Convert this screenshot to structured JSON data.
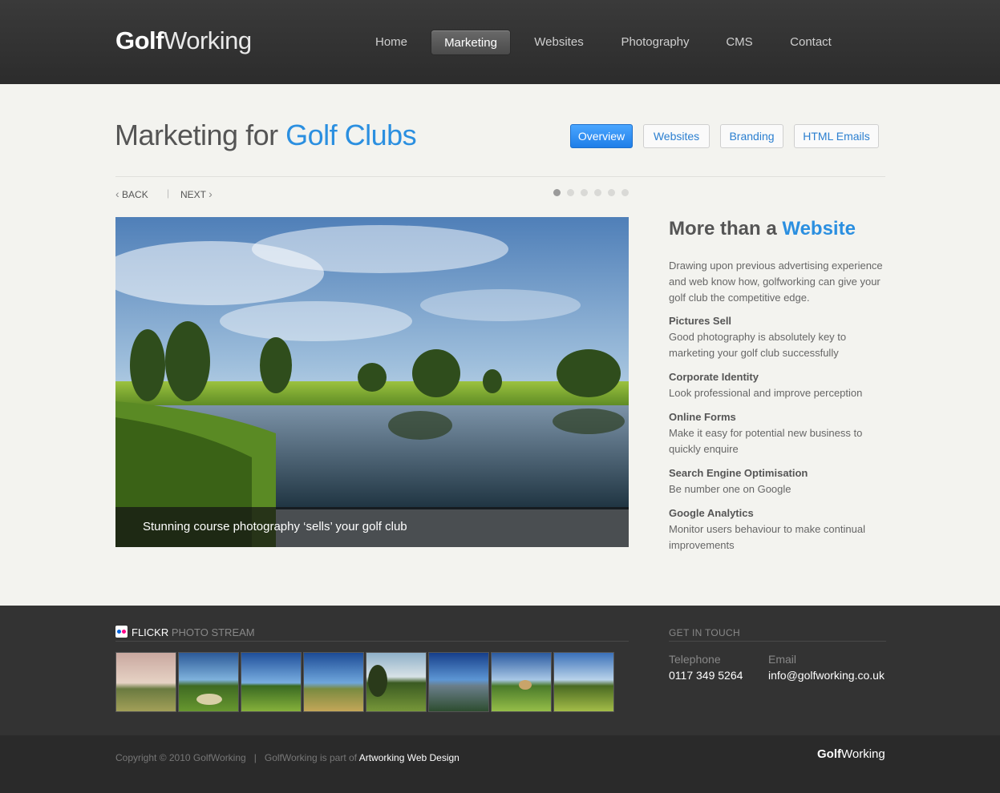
{
  "header": {
    "logo_bold": "Golf",
    "logo_light": "Working",
    "nav": [
      "Home",
      "Marketing",
      "Websites",
      "Photography",
      "CMS",
      "Contact"
    ],
    "active_nav": "Marketing"
  },
  "main": {
    "title_plain": "Marketing for ",
    "title_accent": "Golf Clubs",
    "tabs": [
      "Overview",
      "Websites",
      "Branding",
      "HTML Emails"
    ],
    "active_tab": "Overview",
    "pager": {
      "back": "BACK",
      "next": "NEXT",
      "separator": "|"
    },
    "slides_total": 6,
    "slide_current": 1,
    "caption": "Stunning course photography ‘sells’ your golf club"
  },
  "sidebar": {
    "title_plain": "More than a ",
    "title_accent": "Website",
    "intro": "Drawing upon previous advertising experience and web know how, golfworking can give your golf club the competitive edge.",
    "features": [
      {
        "heading": "Pictures Sell",
        "text": "Good photography is absolutely key to marketing your golf club successfully"
      },
      {
        "heading": "Corporate Identity",
        "text": "Look professional and improve perception"
      },
      {
        "heading": "Online Forms",
        "text": "Make it easy for potential new business to quickly enquire"
      },
      {
        "heading": "Search Engine Optimisation",
        "text": "Be number one on Google"
      },
      {
        "heading": "Google Analytics",
        "text": "Monitor users behaviour to make continual improvements"
      }
    ]
  },
  "footer": {
    "flickr_label": "FLICKR",
    "flickr_sub": " PHOTO STREAM",
    "flickr_icon": "flickr-icon",
    "thumb_count": 8,
    "contact_heading": "GET IN TOUCH",
    "telephone_label": "Telephone",
    "telephone": "0117 349 5264",
    "email_label": "Email",
    "email": "info@golfworking.co.uk",
    "copyright": "Copyright © 2010 GolfWorking",
    "copy_sep": "|",
    "part_of": "GolfWorking is part of ",
    "part_of_link": "Artworking Web Design",
    "logo_bold": "Golf",
    "logo_light": "Working"
  },
  "colors": {
    "accent": "#2b8fe0",
    "header_bg": "#333333",
    "footer_bg": "#333333",
    "page_bg": "#f3f3ef"
  }
}
